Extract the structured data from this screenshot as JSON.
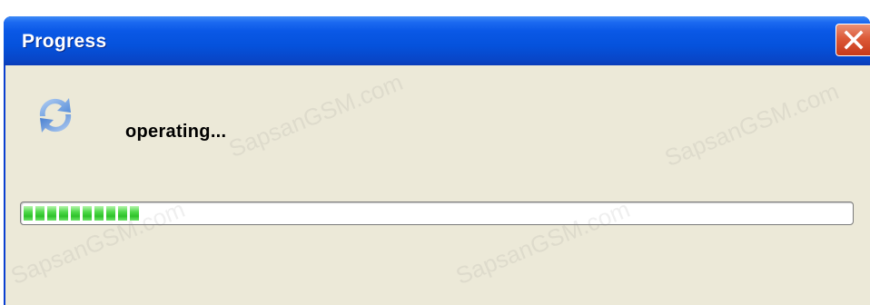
{
  "window": {
    "title": "Progress",
    "close_icon": "close-icon",
    "titlebar_color": "#0552dc",
    "close_color": "#dc5a38",
    "body_color": "#ece9d8"
  },
  "status": {
    "icon": "refresh-icon",
    "text": "operating..."
  },
  "progress": {
    "segments_filled": 10,
    "percent": 17,
    "fill_color": "#2ec22a"
  },
  "watermark": {
    "text": "SapsanGSM.com"
  }
}
